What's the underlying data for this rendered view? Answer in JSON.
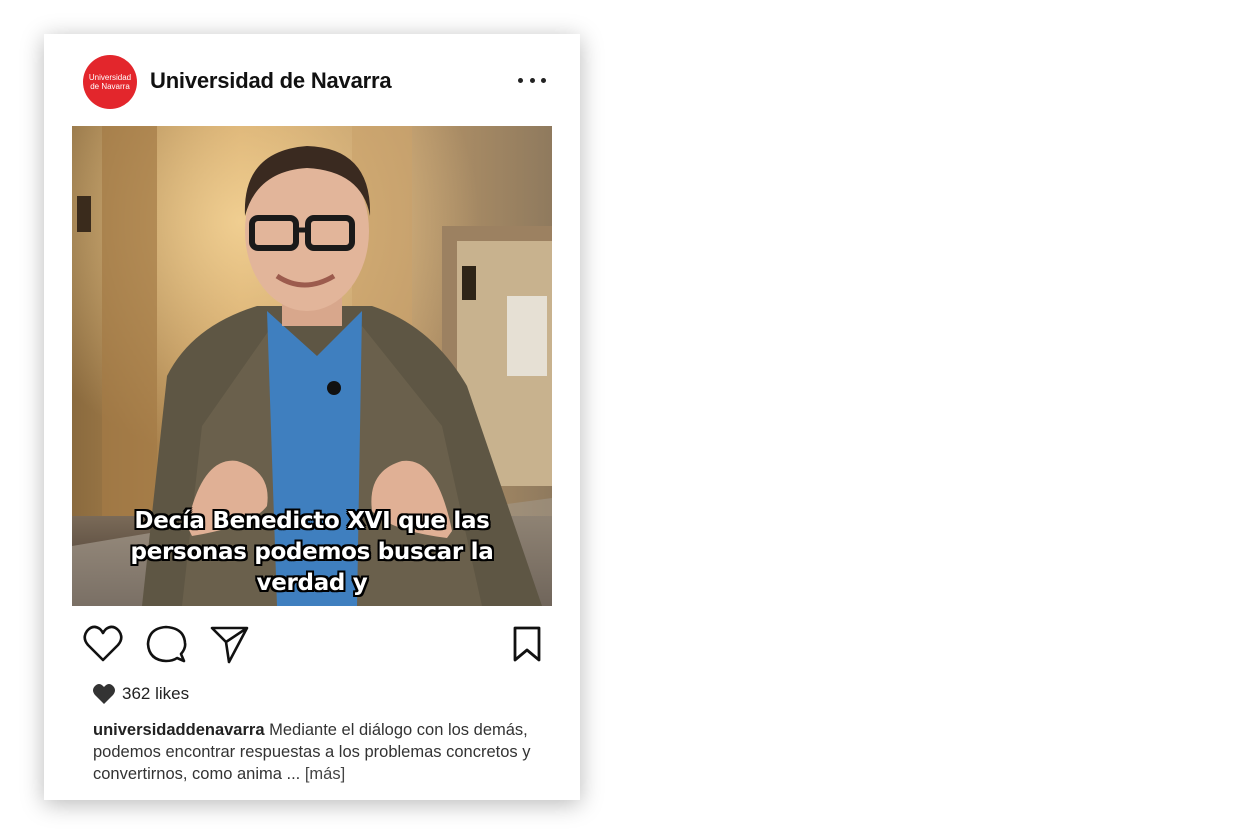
{
  "post": {
    "avatar_line1": "Universidad",
    "avatar_line2": "de Navarra",
    "username": "Universidad de Navarra",
    "overlay_lines": [
      "Decía Benedicto XVI que las",
      "personas podemos buscar la",
      "verdad y"
    ],
    "likes": "362 likes",
    "caption_handle": "universidaddenavarra",
    "caption_text": "Mediante el diálogo con los demás, podemos encontrar respuestas a los problemas concretos y convertirnos, como anima ...",
    "caption_more": "[más]"
  },
  "icons": {
    "more": "more-options-icon",
    "like": "heart-icon",
    "comment": "comment-icon",
    "share": "send-icon",
    "save": "bookmark-icon",
    "likes": "filled-heart-icon"
  },
  "colors": {
    "brand": "#e3262c",
    "text": "#111111"
  }
}
